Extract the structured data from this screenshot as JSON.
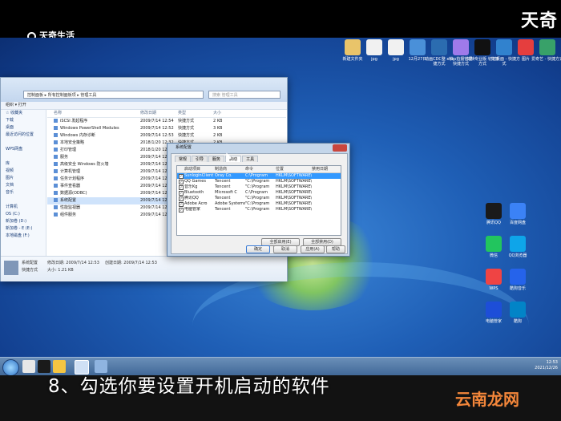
{
  "branding": {
    "top_left": "天奇生活",
    "top_right": "天奇",
    "watermark": "云南龙网"
  },
  "subtitle": "8、勾选你要设置开机启动的软件",
  "desktop_icons_top": [
    {
      "label": "新建文件夹",
      "color": "#e9c46a"
    },
    {
      "label": "jpg",
      "color": "#f1f1f1"
    },
    {
      "label": "jpg",
      "color": "#f1f1f1"
    },
    {
      "label": "12月27日",
      "color": "#4a90d9"
    },
    {
      "label": "动画CDC整 - 快捷方式",
      "color": "#2b6cb0"
    },
    {
      "label": "xhsp拍摄管理 - 快捷方式",
      "color": "#9f7aea"
    },
    {
      "label": "剪映专业版 - 快捷方式",
      "color": "#111111"
    },
    {
      "label": "钉钉桌面 - 快捷方式",
      "color": "#3182ce"
    },
    {
      "label": "图片",
      "color": "#e53e3e"
    },
    {
      "label": "爱奇艺 - 快捷方式",
      "color": "#38a169"
    }
  ],
  "desktop_icons_right": [
    {
      "label": "腾讯QQ",
      "color": "#1a1a1a"
    },
    {
      "label": "百度网盘",
      "color": "#3b82f6"
    },
    {
      "label": "微信",
      "color": "#22c55e"
    },
    {
      "label": "QQ浏览器",
      "color": "#0ea5e9"
    },
    {
      "label": "WPS",
      "color": "#ef4444"
    },
    {
      "label": "酷狗音乐",
      "color": "#2563eb"
    },
    {
      "label": "电脑管家",
      "color": "#1d4ed8"
    },
    {
      "label": "酷狗",
      "color": "#0284c7"
    }
  ],
  "explorer": {
    "address": "控制面板 ▸ 所有控制面板项 ▸ 管理工具",
    "search_placeholder": "搜索 管理工具",
    "toolbar": "组织 ▾   打开",
    "nav": [
      "☆ 收藏夹",
      "下载",
      "桌面",
      "最近访问的位置",
      "",
      "WPS网盘",
      "",
      "库",
      "视频",
      "图片",
      "文档",
      "音乐",
      "",
      "计算机",
      "OS (C:)",
      "新加卷 (D:)",
      "新加卷 - E (E:)",
      "本地磁盘 (F:)"
    ],
    "columns": {
      "name": "名称",
      "date": "修改日期",
      "type": "类型",
      "size": "大小"
    },
    "files": [
      {
        "name": "iSCSI 发起程序",
        "date": "2009/7/14 12:54",
        "type": "快捷方式",
        "size": "2 KB"
      },
      {
        "name": "Windows PowerShell Modules",
        "date": "2009/7/14 12:52",
        "type": "快捷方式",
        "size": "3 KB"
      },
      {
        "name": "Windows 内存诊断",
        "date": "2009/7/14 12:53",
        "type": "快捷方式",
        "size": "2 KB"
      },
      {
        "name": "本地安全策略",
        "date": "2018/1/20 12:32",
        "type": "快捷方式",
        "size": "2 KB"
      },
      {
        "name": "打印管理",
        "date": "2018/1/20 12:32",
        "type": "快捷方式",
        "size": "2 KB"
      },
      {
        "name": "服务",
        "date": "2009/7/14 12:54",
        "type": "快捷方式",
        "size": "2 KB"
      },
      {
        "name": "高级安全 Windows 防火墙",
        "date": "2009/7/14 12:54",
        "type": "快捷方式",
        "size": "2 KB"
      },
      {
        "name": "计算机管理",
        "date": "2009/7/14 12:54",
        "type": "快捷方式",
        "size": "2 KB"
      },
      {
        "name": "任务计划程序",
        "date": "2009/7/14 12:54",
        "type": "快捷方式",
        "size": "2 KB"
      },
      {
        "name": "事件查看器",
        "date": "2009/7/14 12:53",
        "type": "快捷方式",
        "size": "2 KB"
      },
      {
        "name": "数据源(ODBC)",
        "date": "2009/7/14 12:53",
        "type": "快捷方式",
        "size": "2 KB"
      },
      {
        "name": "系统配置",
        "date": "2009/7/14 12:53",
        "type": "快捷方式",
        "size": "2 KB"
      },
      {
        "name": "性能监视器",
        "date": "2009/7/14 12:53",
        "type": "快捷方式",
        "size": "2 KB"
      },
      {
        "name": "组件服务",
        "date": "2009/7/14 12:57",
        "type": "快捷方式",
        "size": "2 KB"
      }
    ],
    "selected_index": 11,
    "details": {
      "name": "系统配置",
      "modified": "修改日期: 2009/7/14 12:53",
      "created": "创建日期: 2009/7/14 12:53",
      "kind": "快捷方式",
      "size": "大小: 1.21 KB"
    }
  },
  "dialog": {
    "title": "系统配置",
    "tabs": [
      "常规",
      "引导",
      "服务",
      "启动",
      "工具"
    ],
    "active_tab": 3,
    "columns": [
      "启动项目",
      "制造商",
      "命令",
      "位置",
      "禁用日期"
    ],
    "rows": [
      {
        "item": "SunloginClient",
        "maker": "Oray Co.",
        "cmd": "C:\\Program",
        "loc": "HKLM\\SOFTWARE\\M...",
        "date": ""
      },
      {
        "item": "QQ Games",
        "maker": "Tencent",
        "cmd": "\"C:\\Program",
        "loc": "HKLM\\SOFTWARE\\M...",
        "date": ""
      },
      {
        "item": "音乐Kg",
        "maker": "Tencent",
        "cmd": "\"C:\\Program",
        "loc": "HKLM\\SOFTWARE\\M...",
        "date": ""
      },
      {
        "item": "Bluetooth",
        "maker": "Microsoft C",
        "cmd": "C:\\Program",
        "loc": "HKLM\\SOFTWARE\\M...",
        "date": ""
      },
      {
        "item": "腾讯QQ",
        "maker": "Tencent",
        "cmd": "\"C:\\Program",
        "loc": "HKLM\\SOFTWARE\\M...",
        "date": ""
      },
      {
        "item": "Adobe Acro",
        "maker": "Adobe Systems",
        "cmd": "\"C:\\Program",
        "loc": "HKLM\\SOFTWARE\\M...",
        "date": ""
      },
      {
        "item": "电脑管家",
        "maker": "Tencent",
        "cmd": "\"C:\\Program",
        "loc": "HKLM\\SOFTWARE\\M...",
        "date": ""
      }
    ],
    "selected_row": 0,
    "enable_all": "全部启用(E)",
    "disable_all": "全部禁用(D)",
    "ok": "确定",
    "cancel": "取消",
    "apply": "应用(A)",
    "help": "帮助"
  },
  "tray": {
    "time": "12:53",
    "date": "2021/12/26"
  }
}
